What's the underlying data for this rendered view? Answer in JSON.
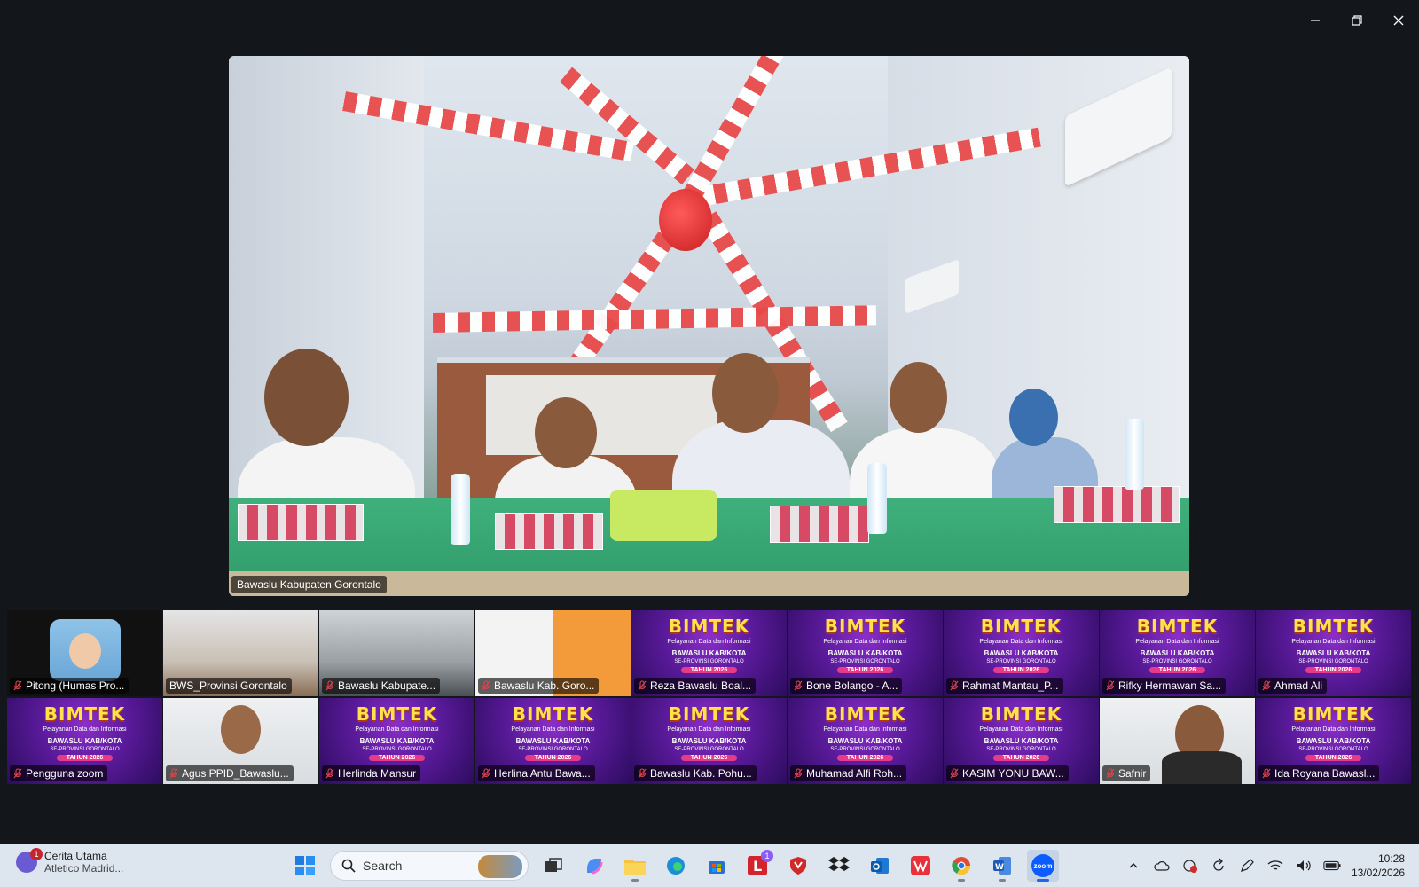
{
  "window": {
    "controls": [
      "minimize-icon",
      "restore-icon",
      "close-icon"
    ]
  },
  "main_speaker": {
    "name": "Bawaslu Kabupaten Gorontalo"
  },
  "gallery": {
    "row1": [
      {
        "name": "Pitong (Humas Pro...",
        "type": "avatar",
        "muted": true
      },
      {
        "name": "BWS_Provinsi Gorontalo",
        "type": "video",
        "muted": false
      },
      {
        "name": "Bawaslu Kabupate...",
        "type": "video",
        "muted": true
      },
      {
        "name": "Bawaslu Kab. Goro...",
        "type": "video",
        "muted": true
      },
      {
        "name": "Reza Bawaslu Boal...",
        "type": "bimtek",
        "muted": true
      },
      {
        "name": "Bone Bolango - A...",
        "type": "bimtek",
        "muted": true
      },
      {
        "name": "Rahmat Mantau_P...",
        "type": "bimtek",
        "muted": true
      },
      {
        "name": "Rifky Hermawan Sa...",
        "type": "bimtek",
        "muted": true
      },
      {
        "name": "Ahmad Ali",
        "type": "bimtek",
        "muted": true
      }
    ],
    "row2": [
      {
        "name": "Pengguna zoom",
        "type": "bimtek",
        "muted": true
      },
      {
        "name": "Agus PPID_Bawaslu...",
        "type": "video",
        "muted": true
      },
      {
        "name": "Herlinda Mansur",
        "type": "bimtek",
        "muted": true
      },
      {
        "name": "Herlina Antu Bawa...",
        "type": "bimtek",
        "muted": true
      },
      {
        "name": "Bawaslu Kab. Pohu...",
        "type": "bimtek",
        "muted": true
      },
      {
        "name": "Muhamad Alfi Roh...",
        "type": "bimtek",
        "muted": true
      },
      {
        "name": "KASIM YONU BAW...",
        "type": "bimtek",
        "muted": true
      },
      {
        "name": "Safnir",
        "type": "video",
        "muted": true
      },
      {
        "name": "Ida Royana Bawasl...",
        "type": "bimtek",
        "muted": true
      }
    ],
    "bimtek_slide": {
      "title": "BIMTEK",
      "subtitle": "Pelayanan Data dan Informasi",
      "line1": "BAWASLU KAB/KOTA",
      "line2": "SE-PROVINSI GORONTALO",
      "year": "TAHUN 2026"
    }
  },
  "taskbar": {
    "news_title": "Cerita Utama",
    "news_sub": "Atletico Madrid...",
    "news_badge": "1",
    "search_placeholder": "Search",
    "time": "10:28",
    "date": "13/02/2026",
    "apps": [
      "windows-start-icon",
      "search",
      "task-view-icon",
      "copilot-icon",
      "file-explorer-icon",
      "edge-icon",
      "store-icon",
      "l-app-icon",
      "shield-app-icon",
      "dropbox-icon",
      "outlook-icon",
      "wps-icon",
      "chrome-icon",
      "word-icon",
      "zoom-icon"
    ],
    "l_app_badge": "1",
    "zoom_label": "zoom"
  },
  "colors": {
    "background": "#13171c",
    "taskbar": "#dde5ef",
    "mute_red": "#e0434b",
    "bimtek_purple": "#5a1a9a",
    "bimtek_yellow": "#ffe14a"
  }
}
